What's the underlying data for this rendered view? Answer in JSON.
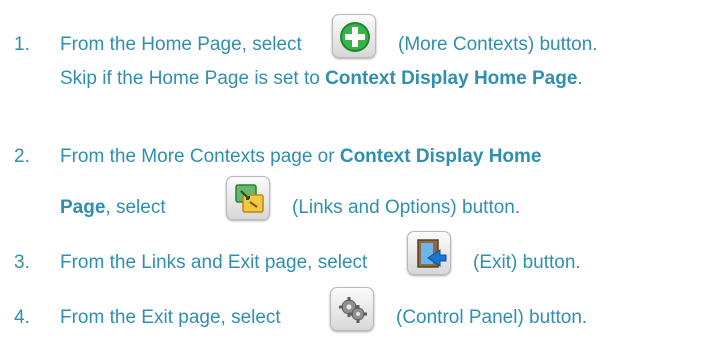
{
  "steps": [
    {
      "number": "1.",
      "line1_before": "From the Home Page, select",
      "line1_after": "(More Contexts) button.",
      "line2_before": "Skip if the Home Page is set to ",
      "line2_bold": "Context Display Home Page",
      "line2_after": ".",
      "icon": "green-plus-icon"
    },
    {
      "number": "2.",
      "line1_before": "From the More Contexts page or ",
      "line1_bold": "Context Display Home",
      "line2_bold": "Page",
      "line2_middle": ", select",
      "line2_after": "(Links and Options) button.",
      "icon": "links-options-icon"
    },
    {
      "number": "3.",
      "text_before": "From the Links and Exit page, select",
      "text_after": "(Exit) button.",
      "icon": "exit-door-icon"
    },
    {
      "number": "4.",
      "text_before": "From the Exit page, select",
      "text_after": "(Control Panel) button.",
      "icon": "gears-icon"
    }
  ],
  "colors": {
    "text": "#2f8fb1",
    "green": "#2e9e3a",
    "blue": "#1976d2",
    "yellow": "#f2c230"
  }
}
